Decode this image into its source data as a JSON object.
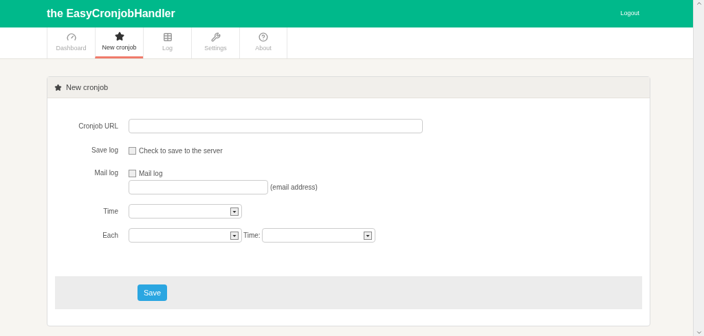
{
  "header": {
    "title": "the EasyCronjobHandler",
    "logout": "Logout"
  },
  "tabs": [
    {
      "label": "Dashboard",
      "selected": false
    },
    {
      "label": "New cronjob",
      "selected": true
    },
    {
      "label": "Log",
      "selected": false
    },
    {
      "label": "Settings",
      "selected": false
    },
    {
      "label": "About",
      "selected": false
    }
  ],
  "panel": {
    "title": "New cronjob",
    "rows": [
      {
        "kind": "text",
        "label": "Cronjob URL"
      },
      {
        "kind": "checkbox",
        "label": "Save log",
        "option": "Check to save to the server",
        "checked": false
      },
      {
        "kind": "email",
        "label": "Mail log",
        "option": "Mail log",
        "checked": false,
        "hint": "(email address)"
      },
      {
        "kind": "select",
        "label": "Time"
      },
      {
        "kind": "select_pair",
        "label": "Each",
        "second_label": "Time:"
      }
    ],
    "save": "Save"
  }
}
